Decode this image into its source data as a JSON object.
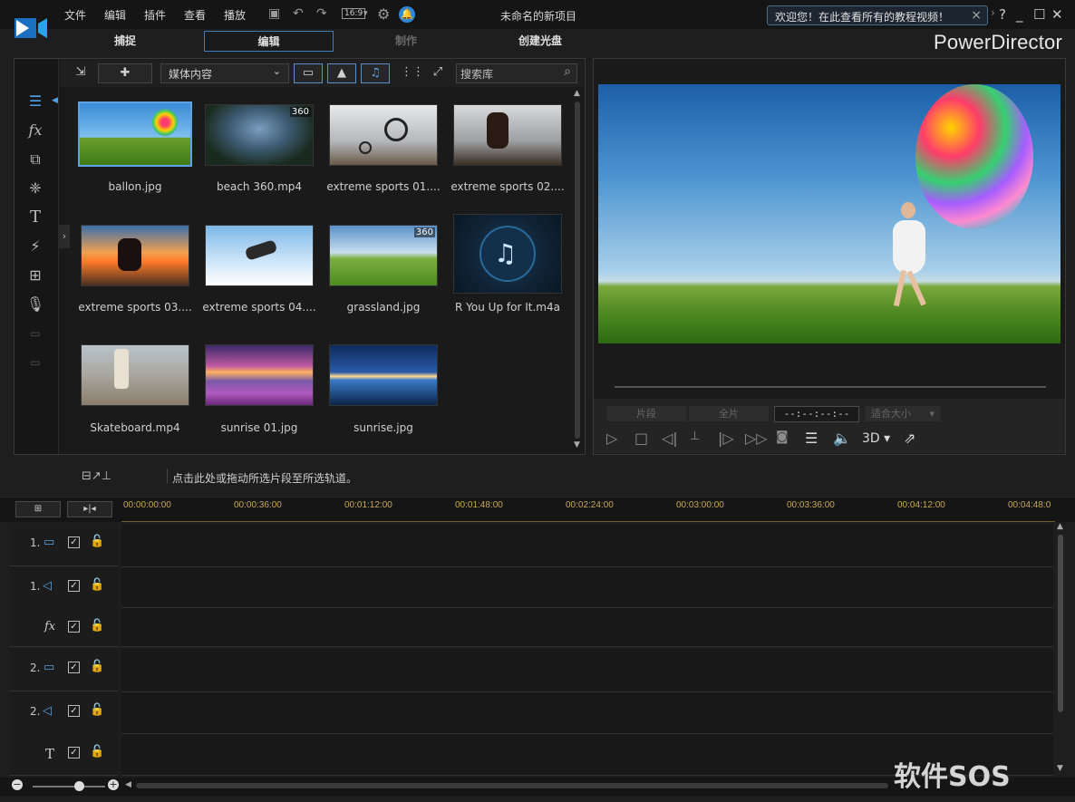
{
  "app": {
    "menu": [
      "文件",
      "编辑",
      "插件",
      "查看",
      "播放"
    ],
    "aspect_ratio": "16:9",
    "project_title": "未命名的新项目",
    "welcome_banner": "欢迎您！在此查看所有的教程视频！",
    "brand": "PowerDirector",
    "accent_color": "#3a7fc0"
  },
  "mode_tabs": [
    {
      "label": "捕捉",
      "state": "normal"
    },
    {
      "label": "编辑",
      "state": "active"
    },
    {
      "label": "制作",
      "state": "disabled"
    },
    {
      "label": "创建光盘",
      "state": "normal"
    }
  ],
  "library": {
    "media_filter": "媒体内容",
    "search_placeholder": "搜索库",
    "items": [
      {
        "label": "ballon.jpg",
        "kind": "image",
        "selected": true
      },
      {
        "label": "beach 360.mp4",
        "kind": "video",
        "badge": "360"
      },
      {
        "label": "extreme sports 01....",
        "kind": "image"
      },
      {
        "label": "extreme sports 02....",
        "kind": "image"
      },
      {
        "label": "extreme sports 03....",
        "kind": "image"
      },
      {
        "label": "extreme sports 04....",
        "kind": "image"
      },
      {
        "label": "grassland.jpg",
        "kind": "image",
        "badge": "360"
      },
      {
        "label": "R You Up for It.m4a",
        "kind": "audio"
      },
      {
        "label": "Skateboard.mp4",
        "kind": "video"
      },
      {
        "label": "sunrise 01.jpg",
        "kind": "image"
      },
      {
        "label": "sunrise.jpg",
        "kind": "image"
      }
    ]
  },
  "preview": {
    "clip_label": "片段",
    "movie_label": "全片",
    "timecode": "--:--:--:--",
    "fit_label": "适合大小",
    "mode_3d": "3D"
  },
  "timeline": {
    "hint": "点击此处或拖动所选片段至所选轨道。",
    "ruler": [
      "00:00:00:00",
      "00:00:36:00",
      "00:01:12:00",
      "00:01:48:00",
      "00:02:24:00",
      "00:03:00:00",
      "00:03:36:00",
      "00:04:12:00",
      "00:04:48:0"
    ],
    "tracks": [
      {
        "num": "1.",
        "type": "video-track-icon"
      },
      {
        "num": "1.",
        "type": "audio-track-icon"
      },
      {
        "num": "",
        "type": "fx-track-icon"
      },
      {
        "num": "2.",
        "type": "video-track-icon"
      },
      {
        "num": "2.",
        "type": "audio-track-icon"
      },
      {
        "num": "",
        "type": "title-track-icon"
      }
    ]
  },
  "watermark": "软件SOS"
}
